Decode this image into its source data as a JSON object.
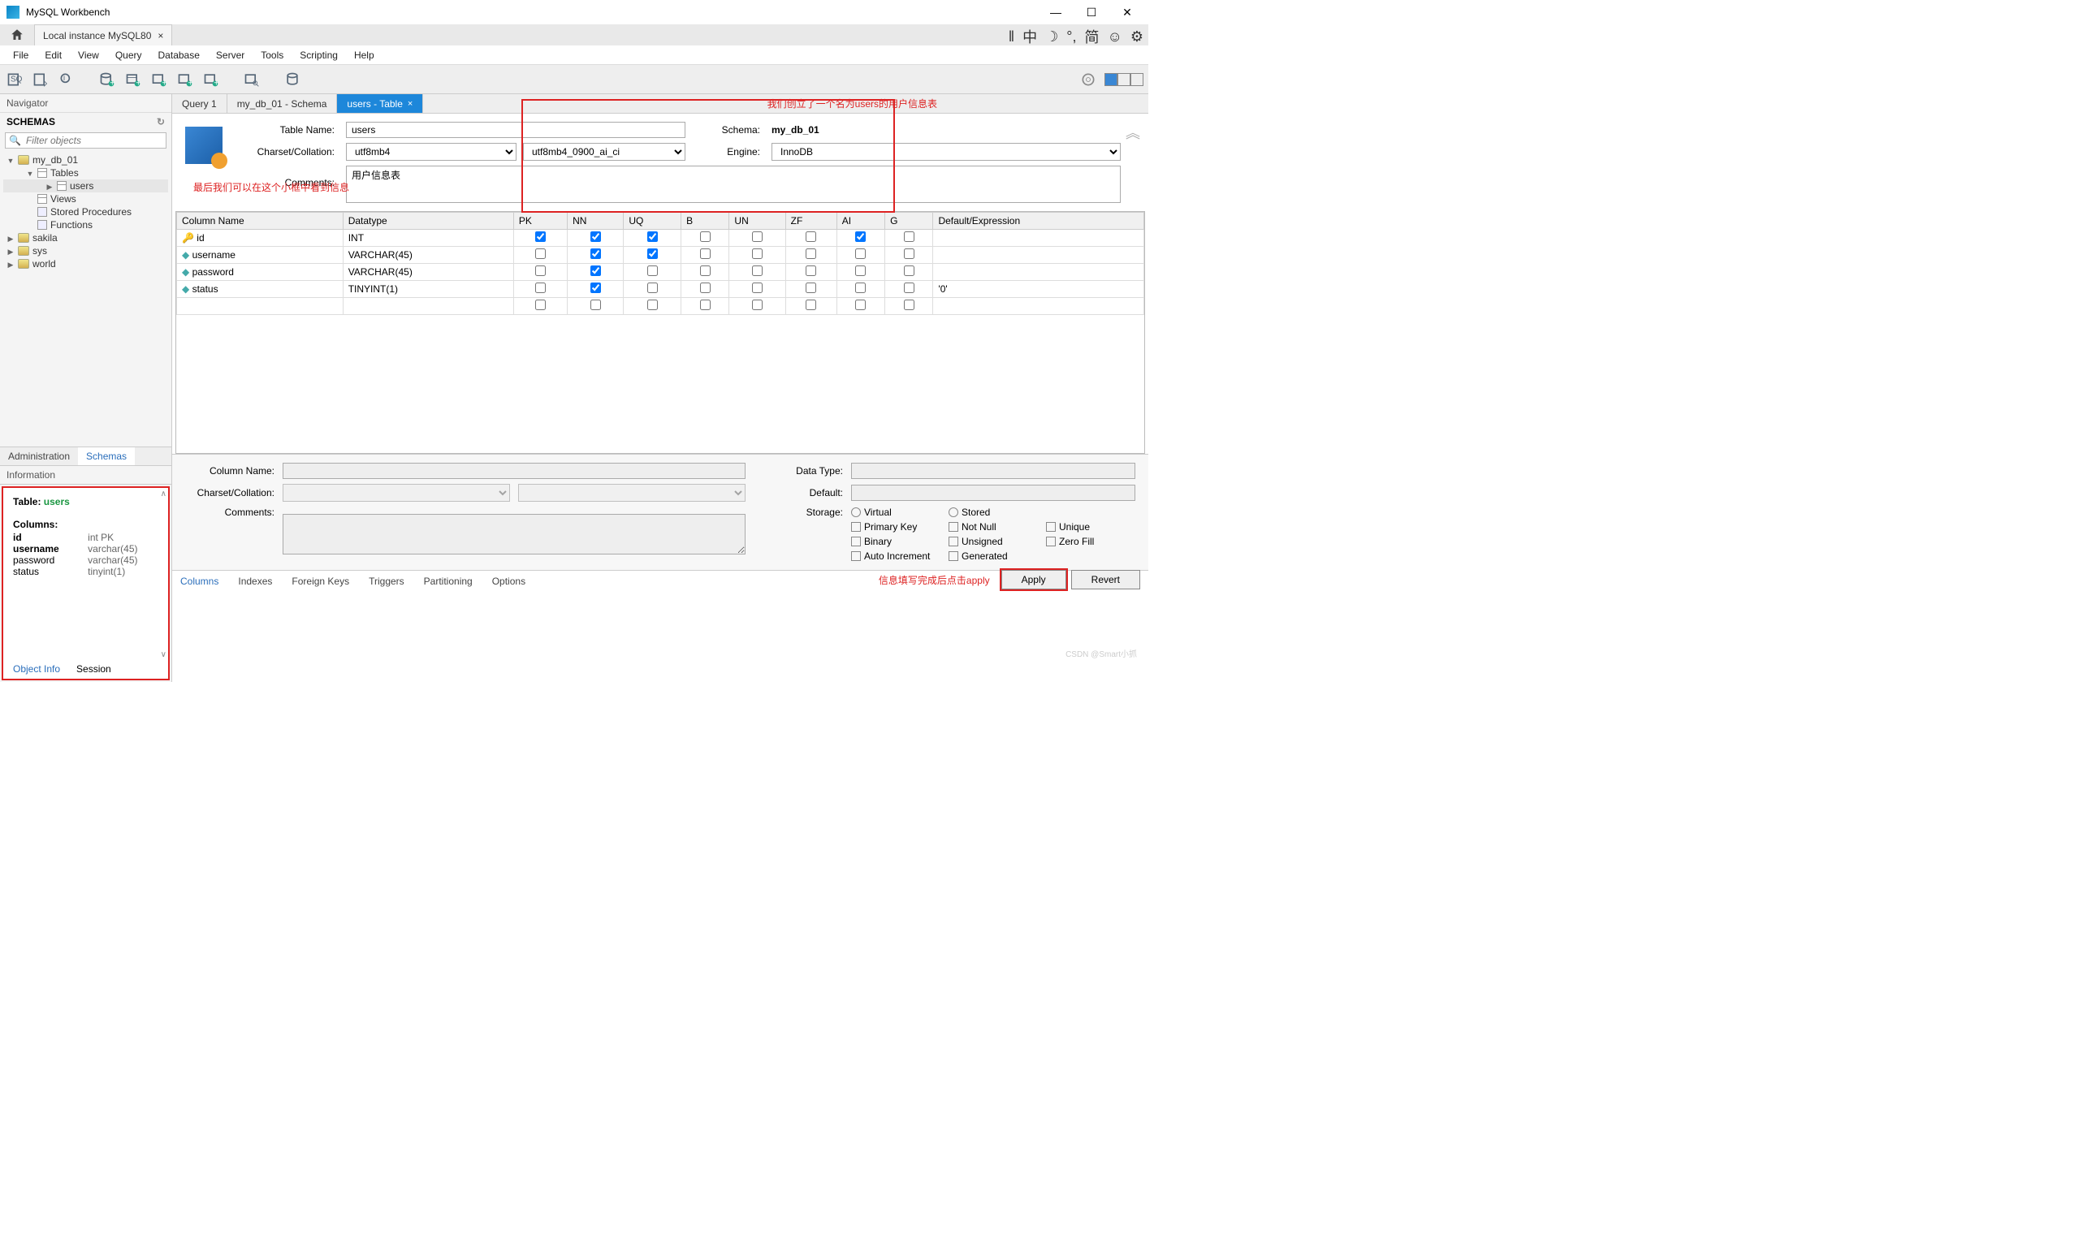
{
  "window": {
    "title": "MySQL Workbench",
    "min": "—",
    "max": "☐",
    "close": "✕"
  },
  "top": {
    "conn_tab": "Local instance MySQL80",
    "conn_close": "×",
    "tools": [
      "‖",
      "中",
      "☽",
      "°,",
      "简",
      "☺",
      "⚙"
    ]
  },
  "menu": [
    "File",
    "Edit",
    "View",
    "Query",
    "Database",
    "Server",
    "Tools",
    "Scripting",
    "Help"
  ],
  "nav": {
    "header": "Navigator",
    "schemas_label": "SCHEMAS",
    "filter_placeholder": "Filter objects",
    "tree": {
      "db": "my_db_01",
      "tables_label": "Tables",
      "tables": [
        "users"
      ],
      "views_label": "Views",
      "sp_label": "Stored Procedures",
      "fn_label": "Functions",
      "others": [
        "sakila",
        "sys",
        "world"
      ]
    },
    "tabs": {
      "admin": "Administration",
      "schemas": "Schemas"
    },
    "info_header": "Information",
    "info": {
      "table_label": "Table:",
      "table_name": "users",
      "columns_label": "Columns:",
      "cols": [
        {
          "name": "id",
          "type": "int PK"
        },
        {
          "name": "username",
          "type": "varchar(45)"
        },
        {
          "name": "password",
          "type": "varchar(45)"
        },
        {
          "name": "status",
          "type": "tinyint(1)"
        }
      ]
    },
    "info_tabs": {
      "obj": "Object Info",
      "sess": "Session"
    }
  },
  "editor_tabs": [
    {
      "label": "Query 1",
      "active": false
    },
    {
      "label": "my_db_01 - Schema",
      "active": false
    },
    {
      "label": "users - Table",
      "active": true
    }
  ],
  "annot": {
    "top": "我们创立了一个名为users的用户信息表",
    "left": "最后我们可以在这个小框中看到信息",
    "apply": "信息填写完成后点击apply"
  },
  "table_form": {
    "name_label": "Table Name:",
    "name": "users",
    "charset_label": "Charset/Collation:",
    "charset": "utf8mb4",
    "collation": "utf8mb4_0900_ai_ci",
    "comments_label": "Comments:",
    "comments": "用户信息表",
    "schema_label": "Schema:",
    "schema": "my_db_01",
    "engine_label": "Engine:",
    "engine": "InnoDB"
  },
  "cols_header": [
    "Column Name",
    "Datatype",
    "PK",
    "NN",
    "UQ",
    "B",
    "UN",
    "ZF",
    "AI",
    "G",
    "Default/Expression"
  ],
  "cols": [
    {
      "icon": "key",
      "name": "id",
      "type": "INT",
      "pk": true,
      "nn": true,
      "uq": true,
      "b": false,
      "un": false,
      "zf": false,
      "ai": true,
      "g": false,
      "def": ""
    },
    {
      "icon": "dia",
      "name": "username",
      "type": "VARCHAR(45)",
      "pk": false,
      "nn": true,
      "uq": true,
      "b": false,
      "un": false,
      "zf": false,
      "ai": false,
      "g": false,
      "def": ""
    },
    {
      "icon": "dia",
      "name": "password",
      "type": "VARCHAR(45)",
      "pk": false,
      "nn": true,
      "uq": false,
      "b": false,
      "un": false,
      "zf": false,
      "ai": false,
      "g": false,
      "def": ""
    },
    {
      "icon": "dia",
      "name": "status",
      "type": "TINYINT(1)",
      "pk": false,
      "nn": true,
      "uq": false,
      "b": false,
      "un": false,
      "zf": false,
      "ai": false,
      "g": false,
      "def": "'0'"
    }
  ],
  "detail": {
    "colname_label": "Column Name:",
    "charset_label": "Charset/Collation:",
    "comments_label": "Comments:",
    "datatype_label": "Data Type:",
    "default_label": "Default:",
    "storage_label": "Storage:",
    "opts": {
      "virtual": "Virtual",
      "stored": "Stored",
      "pk": "Primary Key",
      "nn": "Not Null",
      "uq": "Unique",
      "bin": "Binary",
      "un": "Unsigned",
      "zf": "Zero Fill",
      "ai": "Auto Increment",
      "gen": "Generated"
    }
  },
  "bottom_tabs": [
    "Columns",
    "Indexes",
    "Foreign Keys",
    "Triggers",
    "Partitioning",
    "Options"
  ],
  "buttons": {
    "apply": "Apply",
    "revert": "Revert"
  },
  "watermark": "CSDN @Smart小抓"
}
